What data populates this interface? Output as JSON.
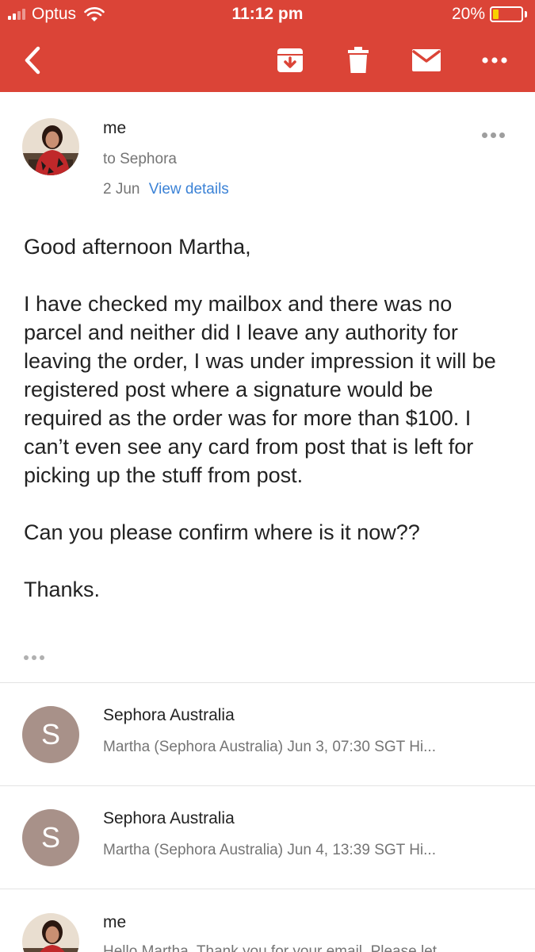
{
  "status_bar": {
    "carrier": "Optus",
    "time": "11:12 pm",
    "battery_percent": "20%",
    "battery_level": 0.2,
    "signal_bars": 2
  },
  "toolbar": {
    "icons": [
      "back-arrow-icon",
      "archive-icon",
      "trash-icon",
      "mail-icon",
      "more-horizontal-icon"
    ]
  },
  "colors": {
    "header_bg": "#db4437",
    "link": "#3b82d6",
    "letter_avatar_bg": "#a89189",
    "battery_fill": "#f8d000"
  },
  "message": {
    "sender": "me",
    "to": "to Sephora",
    "date": "2 Jun",
    "view_details": "View details",
    "body": [
      "Good afternoon Martha,",
      "I have checked my mailbox and there was no parcel and neither did I leave any authority for leaving the order, I was under impression it will be registered post where a signature would be required as the order was for more than $100. I can’t even see any card from post that is left for picking up the stuff from post.",
      "Can you please confirm where is it now??",
      "Thanks."
    ]
  },
  "collapsed": [
    {
      "avatar_letter": "S",
      "sender": "Sephora Australia",
      "snippet": "Martha (Sephora Australia) Jun 3, 07:30 SGT Hi..."
    },
    {
      "avatar_letter": "S",
      "sender": "Sephora Australia",
      "snippet": "Martha (Sephora Australia) Jun 4, 13:39 SGT Hi..."
    },
    {
      "sender": "me",
      "snippet": "Hello Martha, Thank you for your email. Please let"
    }
  ]
}
